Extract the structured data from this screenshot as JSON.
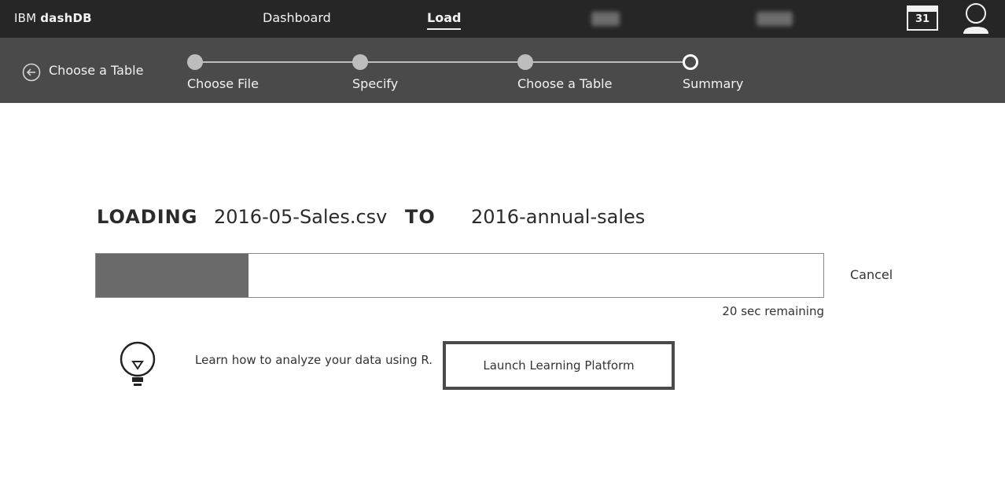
{
  "topnav": {
    "brand_prefix": "IBM",
    "brand_name": "dashDB",
    "links": [
      {
        "label": "Dashboard",
        "active": false
      },
      {
        "label": "Load",
        "active": true
      }
    ],
    "calendar_day": "31"
  },
  "subheader": {
    "back_label": "Choose a Table",
    "steps": [
      {
        "label": "Choose File",
        "state": "done"
      },
      {
        "label": "Specify",
        "state": "done"
      },
      {
        "label": "Choose a Table",
        "state": "done"
      },
      {
        "label": "Summary",
        "state": "current"
      }
    ]
  },
  "main": {
    "loading_keyword": "LOADING",
    "file_name": "2016-05-Sales.csv",
    "to_keyword": "TO",
    "table_name": "2016-annual-sales",
    "progress_percent": 21,
    "cancel_label": "Cancel",
    "remaining_text": "20 sec remaining",
    "tip_text": "Learn how to analyze your data using R.",
    "launch_label": "Launch Learning Platform"
  },
  "colors": {
    "nav_bg": "#262626",
    "subbar_bg": "#4a4a4a",
    "progress_fill": "#6a6a6a"
  },
  "icons": [
    "calendar-icon",
    "user-icon",
    "back-arrow-icon",
    "lightbulb-icon"
  ]
}
